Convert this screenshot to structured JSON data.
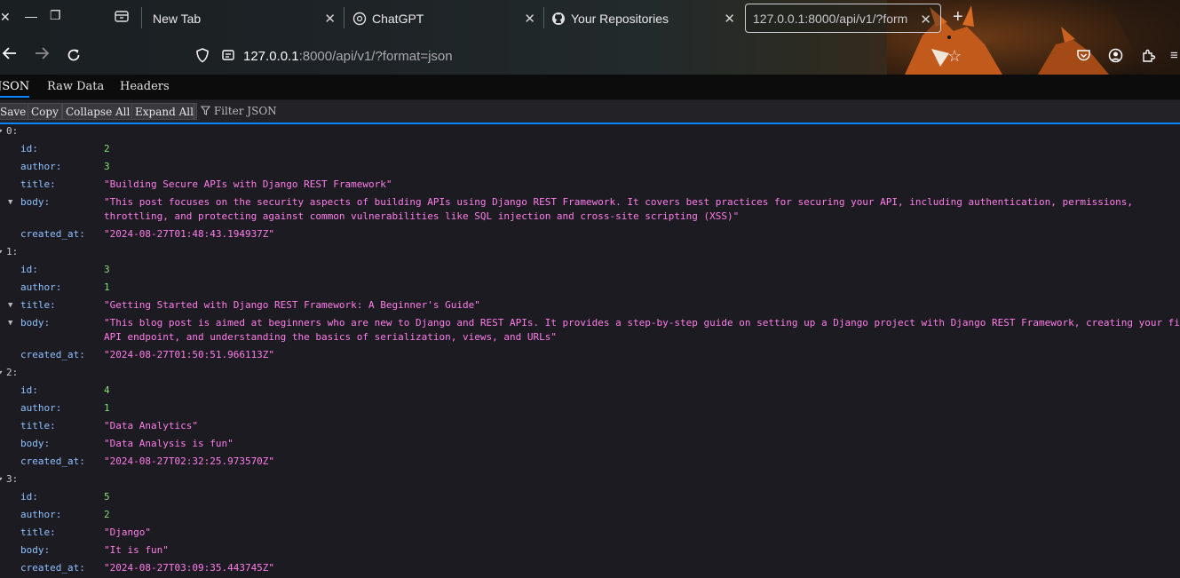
{
  "browser": {
    "tabs": [
      {
        "label": "New Tab"
      },
      {
        "label": "ChatGPT"
      },
      {
        "label": "Your Repositories"
      },
      {
        "label": "127.0.0.1:8000/api/v1/?form"
      }
    ],
    "url_host": "127.0.0.1",
    "url_rest": ":8000/api/v1/?format=json"
  },
  "viewer": {
    "tabs": [
      "JSON",
      "Raw Data",
      "Headers"
    ],
    "toolbar": {
      "save": "Save",
      "copy": "Copy",
      "collapse": "Collapse All",
      "expand": "Expand All",
      "filter": "Filter JSON"
    }
  },
  "posts": [
    {
      "index": "0:",
      "id": "2",
      "author": "3",
      "title": "\"Building Secure APIs with Django REST Framework\"",
      "body_l1": "\"This post focuses on the security aspects of building APIs using Django REST Framework. It covers best practices for securing your API, including authentication, permissions,",
      "body_l2": "throttling, and protecting against common vulnerabilities like SQL injection and cross-site scripting (XSS)\"",
      "created_at": "\"2024-08-27T01:48:43.194937Z\""
    },
    {
      "index": "1:",
      "id": "3",
      "author": "1",
      "title": "\"Getting Started with Django REST Framework: A Beginner's Guide\"",
      "body_l1": "\"This blog post is aimed at beginners who are new to Django and REST APIs. It provides a step-by-step guide on setting up a Django project with Django REST Framework, creating your fi",
      "body_l2": "API endpoint, and understanding the basics of serialization, views, and URLs\"",
      "created_at": "\"2024-08-27T01:50:51.966113Z\""
    },
    {
      "index": "2:",
      "id": "4",
      "author": "1",
      "title": "\"Data Analytics\"",
      "body": "\"Data Analysis is fun\"",
      "created_at": "\"2024-08-27T02:32:25.973570Z\""
    },
    {
      "index": "3:",
      "id": "5",
      "author": "2",
      "title": "\"Django\"",
      "body": "\"It is fun\"",
      "created_at": "\"2024-08-27T03:09:35.443745Z\""
    }
  ],
  "keys": {
    "id": "id:",
    "author": "author:",
    "title": "title:",
    "body": "body:",
    "created_at": "created_at:"
  }
}
